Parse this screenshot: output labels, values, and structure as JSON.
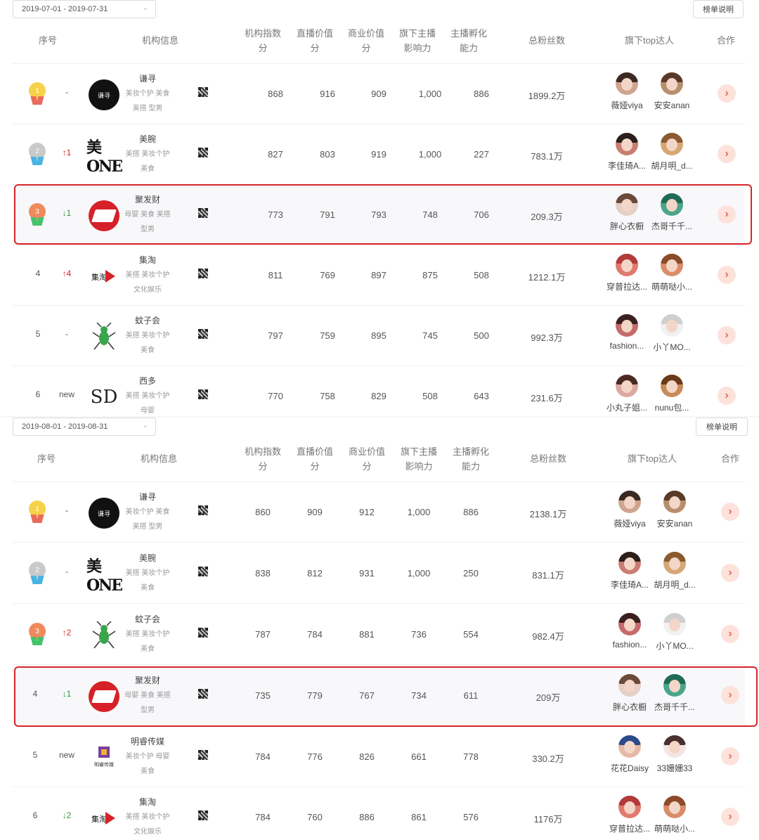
{
  "panels": [
    {
      "date_range": "2019-07-01 - 2019-07-31",
      "rank_note": "榜单说明",
      "headers": {
        "rank": "序号",
        "org_info": "机构信息",
        "org_index_1": "机构指数",
        "org_index_2": "分",
        "live_value_1": "直播价值",
        "live_value_2": "分",
        "biz_value_1": "商业价值",
        "biz_value_2": "分",
        "anchor_influence_1": "旗下主播",
        "anchor_influence_2": "影响力",
        "incubation_1": "主播孵化",
        "incubation_2": "能力",
        "fans": "总粉丝数",
        "top_talents": "旗下top达人",
        "coop": "合作"
      },
      "rows": [
        {
          "rank": "1",
          "change": "-",
          "org": "谦寻",
          "tags_1": "美妆个护 美食",
          "tags_2": "美搭 型男",
          "logo_text": "谦寻",
          "org_index": "868",
          "live_value": "916",
          "biz_value": "909",
          "anchor_influence": "1,000",
          "incubation": "886",
          "fans": "1899.2万",
          "talent_1": "薇娅viya",
          "talent_2": "安安anan"
        },
        {
          "rank": "2",
          "change": "↑1",
          "org": "美腕",
          "tags_1": "美搭 美妆个护",
          "tags_2": "美食",
          "logo_text": "美ONE",
          "org_index": "827",
          "live_value": "803",
          "biz_value": "919",
          "anchor_influence": "1,000",
          "incubation": "227",
          "fans": "783.1万",
          "talent_1": "李佳琦A...",
          "talent_2": "胡月明_d..."
        },
        {
          "rank": "3",
          "change": "↓1",
          "org": "聚发财",
          "tags_1": "母婴 美食 美搭",
          "tags_2": "型男",
          "org_index": "773",
          "live_value": "791",
          "biz_value": "793",
          "anchor_influence": "748",
          "incubation": "706",
          "fans": "209.3万",
          "talent_1": "胖心衣橱",
          "talent_2": "杰哥千千..."
        },
        {
          "rank": "4",
          "change": "↑4",
          "org": "集淘",
          "tags_1": "美搭 美妆个护",
          "tags_2": "文化娱乐",
          "logo_text": "集淘",
          "org_index": "811",
          "live_value": "769",
          "biz_value": "897",
          "anchor_influence": "875",
          "incubation": "508",
          "fans": "1212.1万",
          "talent_1": "穿普拉达...",
          "talent_2": "萌萌哒小..."
        },
        {
          "rank": "5",
          "change": "-",
          "org": "蚊子会",
          "tags_1": "美搭 美妆个护",
          "tags_2": "美食",
          "org_index": "797",
          "live_value": "759",
          "biz_value": "895",
          "anchor_influence": "745",
          "incubation": "500",
          "fans": "992.3万",
          "talent_1": "fashion...",
          "talent_2": "小丫MO..."
        },
        {
          "rank": "6",
          "change": "new",
          "org": "西多",
          "tags_1": "美搭 美妆个护",
          "tags_2": "母婴",
          "logo_text": "SD",
          "org_index": "770",
          "live_value": "758",
          "biz_value": "829",
          "anchor_influence": "508",
          "incubation": "643",
          "fans": "231.6万",
          "talent_1": "小丸子姐...",
          "talent_2": "nunu包..."
        }
      ]
    },
    {
      "date_range": "2019-08-01 - 2019-08-31",
      "rank_note": "榜单说明",
      "headers": {
        "rank": "序号",
        "org_info": "机构信息",
        "org_index_1": "机构指数",
        "org_index_2": "分",
        "live_value_1": "直播价值",
        "live_value_2": "分",
        "biz_value_1": "商业价值",
        "biz_value_2": "分",
        "anchor_influence_1": "旗下主播",
        "anchor_influence_2": "影响力",
        "incubation_1": "主播孵化",
        "incubation_2": "能力",
        "fans": "总粉丝数",
        "top_talents": "旗下top达人",
        "coop": "合作"
      },
      "rows": [
        {
          "rank": "1",
          "change": "-",
          "org": "谦寻",
          "tags_1": "美妆个护 美食",
          "tags_2": "美搭 型男",
          "logo_text": "谦寻",
          "org_index": "860",
          "live_value": "909",
          "biz_value": "912",
          "anchor_influence": "1,000",
          "incubation": "886",
          "fans": "2138.1万",
          "talent_1": "薇娅viya",
          "talent_2": "安安anan"
        },
        {
          "rank": "2",
          "change": "-",
          "org": "美腕",
          "tags_1": "美搭 美妆个护",
          "tags_2": "美食",
          "logo_text": "美ONE",
          "org_index": "838",
          "live_value": "812",
          "biz_value": "931",
          "anchor_influence": "1,000",
          "incubation": "250",
          "fans": "831.1万",
          "talent_1": "李佳琦A...",
          "talent_2": "胡月明_d..."
        },
        {
          "rank": "3",
          "change": "↑2",
          "org": "蚊子会",
          "tags_1": "美搭 美妆个护",
          "tags_2": "美食",
          "org_index": "787",
          "live_value": "784",
          "biz_value": "881",
          "anchor_influence": "736",
          "incubation": "554",
          "fans": "982.4万",
          "talent_1": "fashion...",
          "talent_2": "小丫MO..."
        },
        {
          "rank": "4",
          "change": "↓1",
          "org": "聚发财",
          "tags_1": "母婴 美食 美搭",
          "tags_2": "型男",
          "org_index": "735",
          "live_value": "779",
          "biz_value": "767",
          "anchor_influence": "734",
          "incubation": "611",
          "fans": "209万",
          "talent_1": "胖心衣橱",
          "talent_2": "杰哥千千..."
        },
        {
          "rank": "5",
          "change": "new",
          "org": "明睿传媒",
          "tags_1": "美妆个护 母婴",
          "tags_2": "美食",
          "logo_text": "明睿传媒",
          "org_index": "784",
          "live_value": "776",
          "biz_value": "826",
          "anchor_influence": "661",
          "incubation": "778",
          "fans": "330.2万",
          "talent_1": "花花Daisy",
          "talent_2": "33姗姗33"
        },
        {
          "rank": "6",
          "change": "↓2",
          "org": "集淘",
          "tags_1": "美搭 美妆个护",
          "tags_2": "文化娱乐",
          "logo_text": "集淘",
          "org_index": "784",
          "live_value": "760",
          "biz_value": "886",
          "anchor_influence": "861",
          "incubation": "576",
          "fans": "1176万",
          "talent_1": "穿普拉达...",
          "talent_2": "萌萌哒小..."
        }
      ]
    }
  ],
  "colors": {
    "highlight_border": "#d8252b",
    "rank_up": "#d8252b",
    "rank_down": "#2f9a3d",
    "coop_button_bg": "#fde2dc",
    "coop_button_fg": "#e86a53"
  }
}
